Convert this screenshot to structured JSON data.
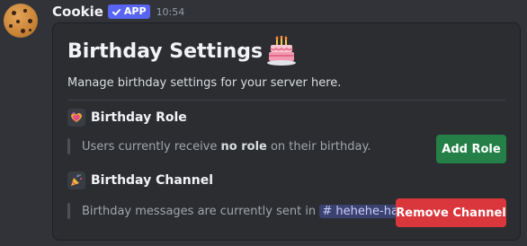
{
  "message": {
    "username": "Cookie",
    "app_badge": "APP",
    "timestamp": "10:54"
  },
  "card": {
    "title": "Birthday Settings",
    "description": "Manage birthday settings for your server here.",
    "role_section": {
      "heading": "Birthday Role",
      "text_prefix": "Users currently receive ",
      "text_bold": "no role",
      "text_suffix": " on their birthday.",
      "button_label": "Add Role"
    },
    "channel_section": {
      "heading": "Birthday Channel",
      "text_prefix": "Birthday messages are currently sent in ",
      "channel_name": "# hehehe-ha",
      "text_suffix": ".",
      "button_label": "Remove Channel"
    }
  },
  "colors": {
    "background": "#323339",
    "card": "#2b2d31",
    "app_badge": "#5865f2",
    "add_button": "#248046",
    "remove_button": "#da373c",
    "channel_mention": "#3c4270"
  },
  "icons": {
    "avatar": "cookie-avatar",
    "title_emoji": "birthday-cake-icon",
    "role_icon": "balloon-heart-icon",
    "channel_icon": "party-popper-icon"
  }
}
